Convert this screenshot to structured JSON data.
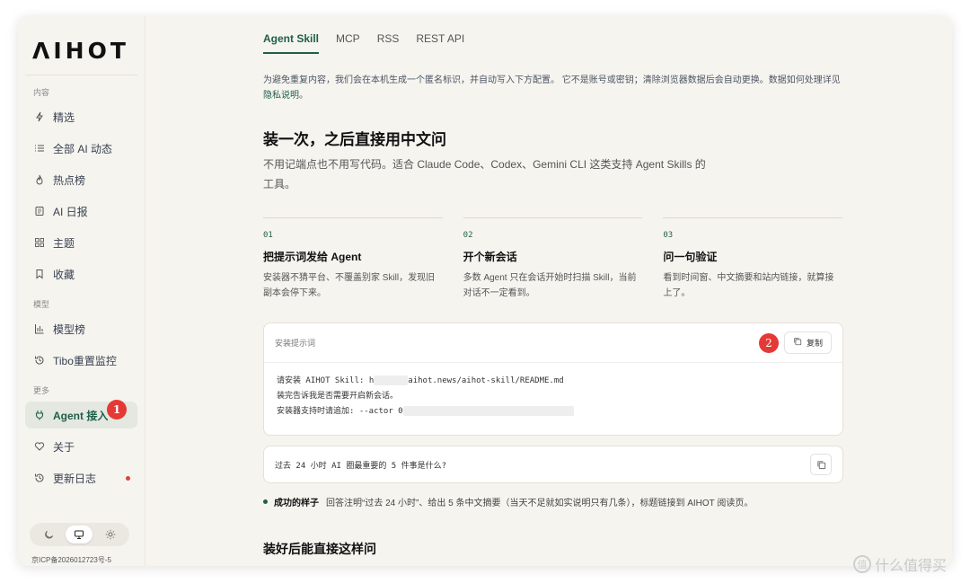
{
  "sidebar": {
    "logo": "ΛIHOT",
    "section_content": "内容",
    "section_model": "模型",
    "section_more": "更多",
    "items_content": [
      {
        "label": "精选",
        "icon": "lightning-icon"
      },
      {
        "label": "全部 AI 动态",
        "icon": "list-icon"
      },
      {
        "label": "热点榜",
        "icon": "flame-icon"
      },
      {
        "label": "AI 日报",
        "icon": "newspaper-icon"
      },
      {
        "label": "主题",
        "icon": "grid-icon"
      },
      {
        "label": "收藏",
        "icon": "bookmark-icon"
      }
    ],
    "items_model": [
      {
        "label": "模型榜",
        "icon": "bar-chart-icon"
      },
      {
        "label": "Tibo重置监控",
        "icon": "history-icon"
      }
    ],
    "items_more": [
      {
        "label": "Agent 接入",
        "icon": "plug-icon",
        "active": true
      },
      {
        "label": "关于",
        "icon": "heart-icon"
      },
      {
        "label": "更新日志",
        "icon": "history-icon",
        "dot": true
      }
    ],
    "icp": "京ICP备2026012723号-5"
  },
  "badges": {
    "one": "1",
    "two": "2"
  },
  "tabs": [
    {
      "label": "Agent Skill",
      "active": true
    },
    {
      "label": "MCP"
    },
    {
      "label": "RSS"
    },
    {
      "label": "REST API"
    }
  ],
  "notice": {
    "text": "为避免重复内容，我们会在本机生成一个匿名标识，并自动写入下方配置。 它不是账号或密钥；清除浏览器数据后会自动更换。数据如何处理详见",
    "link": "隐私说明",
    "tail": "。"
  },
  "heading": "装一次，之后直接用中文问",
  "lead": "不用记端点也不用写代码。适合 Claude Code、Codex、Gemini CLI 这类支持 Agent Skills 的工具。",
  "steps": [
    {
      "num": "01",
      "title": "把提示词发给 Agent",
      "desc": "安装器不猜平台、不覆盖别家 Skill，发现旧副本会停下来。"
    },
    {
      "num": "02",
      "title": "开个新会话",
      "desc": "多数 Agent 只在会话开始时扫描 Skill，当前对话不一定看到。"
    },
    {
      "num": "03",
      "title": "问一句验证",
      "desc": "看到时间窗、中文摘要和站内链接，就算接上了。"
    }
  ],
  "install_card": {
    "label": "安装提示词",
    "copy_label": "复制",
    "line1_a": "请安装 AIHOT Skill: h",
    "line1_b": "aihot.news/aihot-skill/README.md",
    "line2": "装完告诉我是否需要开启新会话。",
    "line3": "安装器支持时请追加: --actor 0"
  },
  "prompt2": "过去 24 小时 AI 圈最重要的 5 件事是什么?",
  "success": {
    "label": "成功的样子",
    "text": "回答注明“过去 24 小时”、给出 5 条中文摘要（当天不足就如实说明只有几条），标题链接到 AIHOT 阅读页。"
  },
  "heading2": "装好后能直接这样问",
  "theme_icons": [
    "moon-icon",
    "monitor-icon",
    "sun-icon"
  ],
  "watermark": "什么值得买"
}
